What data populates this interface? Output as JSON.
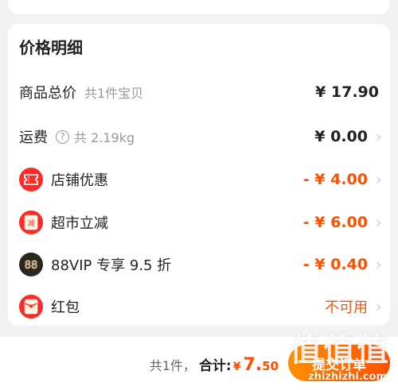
{
  "price_detail": {
    "title": "价格明细",
    "rows": [
      {
        "label": "商品总价",
        "sub": "共1件宝贝",
        "amount": "¥ 17.90",
        "has_chevron": false
      },
      {
        "label": "运费",
        "sub": "共 2.19kg",
        "amount": "¥ 0.00",
        "has_chevron": true,
        "icon": "help-circle-icon",
        "icon_glyph": "?"
      },
      {
        "label": "店铺优惠",
        "amount": "- ¥ 4.00",
        "has_chevron": true,
        "icon": "shop-coupon-icon"
      },
      {
        "label": "超市立减",
        "amount": "- ¥ 6.00",
        "has_chevron": true,
        "icon": "supermarket-discount-icon",
        "icon_glyph": "减"
      },
      {
        "label": "88VIP 专享 9.5 折",
        "amount": "- ¥ 0.40",
        "has_chevron": true,
        "icon": "vip-88-icon",
        "icon_glyph": "88"
      },
      {
        "label": "红包",
        "amount": "不可用",
        "has_chevron": true,
        "icon": "red-packet-icon"
      }
    ],
    "chevron_glyph": "›"
  },
  "bottom_bar": {
    "count_text": "共1件，",
    "total_label": "合计:",
    "currency": "¥",
    "total_integer": "7.",
    "total_decimal": "50",
    "submit_label": "提交订单"
  },
  "watermark": {
    "logo_text": "值值值",
    "site_text": "zhizhizhi.com"
  },
  "colors": {
    "accent": "#ff5000",
    "icon_red": "#ff2a24",
    "vip_dark": "#2c2620",
    "background": "#f2f2f2"
  }
}
